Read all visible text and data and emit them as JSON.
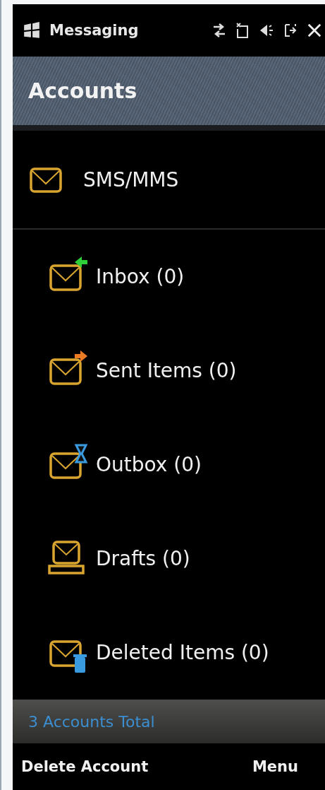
{
  "title_bar": {
    "title": "Messaging"
  },
  "header": {
    "title": "Accounts"
  },
  "accounts": [
    {
      "name": "SMS/MMS",
      "children": [
        {
          "kind": "inbox",
          "label": "Inbox (0)"
        },
        {
          "kind": "sent",
          "label": "Sent Items (0)"
        },
        {
          "kind": "outbox",
          "label": "Outbox (0)"
        },
        {
          "kind": "drafts",
          "label": "Drafts (0)"
        },
        {
          "kind": "deleted",
          "label": "Deleted Items (0)"
        }
      ]
    }
  ],
  "status_bar": {
    "text": "3 Accounts Total"
  },
  "softkeys": {
    "left": "Delete Account",
    "right": "Menu"
  }
}
